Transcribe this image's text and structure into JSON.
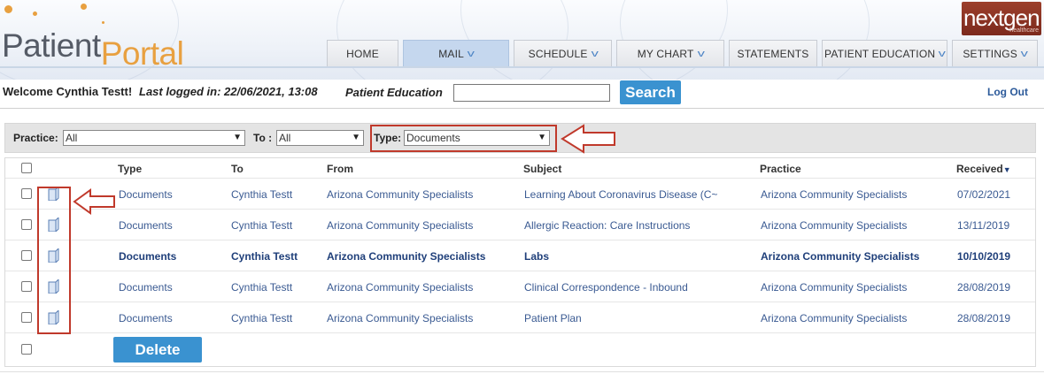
{
  "brand": {
    "portal_part1": "Patient",
    "portal_part2": "Portal",
    "vendor": "nextgen",
    "vendor_sub": "healthcare"
  },
  "nav": {
    "tabs": [
      {
        "label": "HOME",
        "dropdown": false
      },
      {
        "label": "MAIL",
        "dropdown": true,
        "active": true
      },
      {
        "label": "SCHEDULE",
        "dropdown": true
      },
      {
        "label": "MY CHART",
        "dropdown": true
      },
      {
        "label": "STATEMENTS",
        "dropdown": false
      },
      {
        "label": "PATIENT EDUCATION",
        "dropdown": true
      },
      {
        "label": "SETTINGS",
        "dropdown": true
      }
    ]
  },
  "welcome": {
    "greeting": "Welcome Cynthia Testt!",
    "last_login": "Last logged in: 22/06/2021, 13:08",
    "patient_education_label": "Patient Education",
    "search_value": "",
    "search_button": "Search",
    "logout": "Log Out"
  },
  "filters": {
    "practice_label": "Practice:",
    "practice_value": "All",
    "to_label": "To :",
    "to_value": "All",
    "type_label": "Type:",
    "type_value": "Documents"
  },
  "table": {
    "headers": {
      "type": "Type",
      "to": "To",
      "from": "From",
      "subject": "Subject",
      "practice": "Practice",
      "received": "Received"
    },
    "rows": [
      {
        "type": "Documents",
        "to": "Cynthia Testt",
        "from": "Arizona Community Specialists",
        "subject": "Learning About Coronavirus Disease (C~",
        "practice": "Arizona Community Specialists",
        "received": "07/02/2021",
        "unread": false
      },
      {
        "type": "Documents",
        "to": "Cynthia Testt",
        "from": "Arizona Community Specialists",
        "subject": "Allergic Reaction: Care Instructions",
        "practice": "Arizona Community Specialists",
        "received": "13/11/2019",
        "unread": false
      },
      {
        "type": "Documents",
        "to": "Cynthia Testt",
        "from": "Arizona Community Specialists",
        "subject": "Labs",
        "practice": "Arizona Community Specialists",
        "received": "10/10/2019",
        "unread": true
      },
      {
        "type": "Documents",
        "to": "Cynthia Testt",
        "from": "Arizona Community Specialists",
        "subject": "Clinical Correspondence - Inbound",
        "practice": "Arizona Community Specialists",
        "received": "28/08/2019",
        "unread": false
      },
      {
        "type": "Documents",
        "to": "Cynthia Testt",
        "from": "Arizona Community Specialists",
        "subject": "Patient Plan",
        "practice": "Arizona Community Specialists",
        "received": "28/08/2019",
        "unread": false
      }
    ],
    "delete_button": "Delete"
  },
  "colors": {
    "accent": "#3a92d0",
    "annotation": "#c0392b",
    "link": "#3a5a92"
  }
}
